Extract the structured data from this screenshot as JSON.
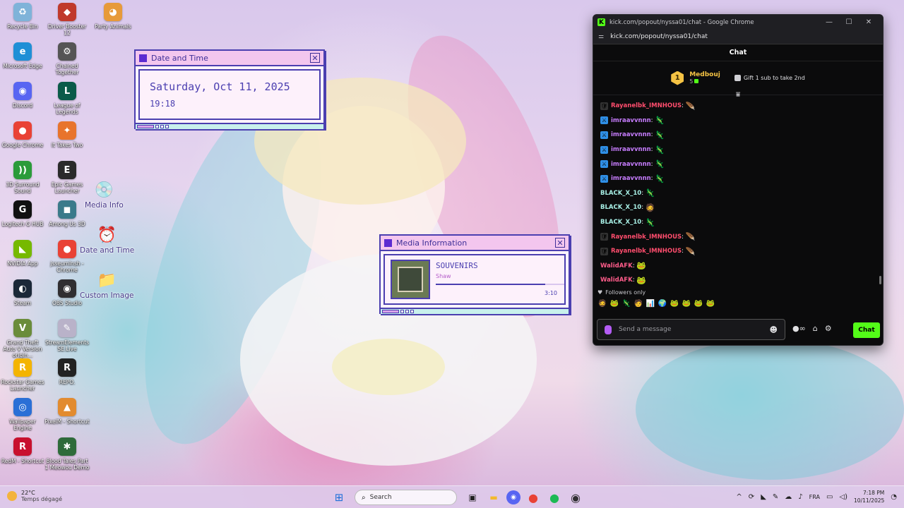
{
  "desktop": {
    "icons_col1": [
      {
        "label": "Recycle Bin",
        "glyph": "♻",
        "color": "#7fb3d9"
      },
      {
        "label": "Microsoft Edge",
        "glyph": "e",
        "color": "#1f8fd6"
      },
      {
        "label": "Discord",
        "glyph": "◉",
        "color": "#5865f2"
      },
      {
        "label": "Google Chrome",
        "glyph": "●",
        "color": "#e94235"
      },
      {
        "label": "3D Surround Sound",
        "glyph": "))",
        "color": "#2b9b3a"
      },
      {
        "label": "Logitech G HUB",
        "glyph": "G",
        "color": "#111111"
      },
      {
        "label": "NVIDIA App",
        "glyph": "◣",
        "color": "#76b900"
      },
      {
        "label": "Steam",
        "glyph": "◐",
        "color": "#1b2838"
      },
      {
        "label": "Grand Theft Auto V Version origin...",
        "glyph": "V",
        "color": "#6a8c3a"
      },
      {
        "label": "Rockstar Games Launcher",
        "glyph": "R",
        "color": "#f4b400"
      },
      {
        "label": "Wallpaper Engine",
        "glyph": "◎",
        "color": "#2a6fd6"
      },
      {
        "label": "RedM - Shortcut",
        "glyph": "R",
        "color": "#c8102e"
      }
    ],
    "icons_col2": [
      {
        "label": "Driver Booster 12",
        "glyph": "◆",
        "color": "#c0392b"
      },
      {
        "label": "Chained Together",
        "glyph": "⚙",
        "color": "#555555"
      },
      {
        "label": "League of Legends",
        "glyph": "L",
        "color": "#0a5b49"
      },
      {
        "label": "It Takes Two",
        "glyph": "✦",
        "color": "#e8742c"
      },
      {
        "label": "Epic Games Launcher",
        "glyph": "E",
        "color": "#2a2a2a"
      },
      {
        "label": "Among Us 3D",
        "glyph": "◼",
        "color": "#3a7a8a"
      },
      {
        "label": "jsseumlnsh - Chrome",
        "glyph": "●",
        "color": "#e94235"
      },
      {
        "label": "OBS Studio",
        "glyph": "◉",
        "color": "#302e31"
      },
      {
        "label": "StreamElements SE.Live",
        "glyph": "✎",
        "color": "#b9b2c9"
      },
      {
        "label": "REPO.",
        "glyph": "R",
        "color": "#222222"
      },
      {
        "label": "PixelM - Shortcut",
        "glyph": "▲",
        "color": "#e28b2f"
      },
      {
        "label": "Blood Tales Part 1 Meowou Demo",
        "glyph": "✱",
        "color": "#2e6b3a"
      }
    ],
    "icon_col3": {
      "label": "Party Animals",
      "glyph": "◕",
      "color": "#e79a3a"
    },
    "widget_shortcuts": [
      {
        "label": "Media Info",
        "glyph": "💿"
      },
      {
        "label": "Date and Time",
        "glyph": "⏰"
      },
      {
        "label": "Custom Image",
        "glyph": "📁"
      }
    ]
  },
  "date_widget": {
    "title": "Date and Time",
    "date": "Saturday, Oct 11, 2025",
    "time": "19:18"
  },
  "media_widget": {
    "title": "Media Information",
    "track": "SOUVENIRS",
    "artist": "Shaw",
    "duration": "3:10",
    "progress": 0.85
  },
  "browser": {
    "window_title": "kick.com/popout/nyssa01/chat - Google Chrome",
    "url": "kick.com/popout/nyssa01/chat",
    "chat_header": "Chat",
    "leader": {
      "rank": "1",
      "name": "Medbouj",
      "count": "5",
      "gift_text": "Gift 1 sub to take 2nd"
    },
    "messages": [
      {
        "user": "Rayanelbk_IMNHOUS",
        "color": "#ff4d6d",
        "badge": "🛡",
        "badge_bg": "#333",
        "emote": "🪶",
        "emote_bg": ""
      },
      {
        "user": "imraavvnnn",
        "color": "#c77dff",
        "badge": "⚔",
        "badge_bg": "#2f8fe6",
        "emote": "🦎",
        "emote_bg": ""
      },
      {
        "user": "imraavvnnn",
        "color": "#c77dff",
        "badge": "⚔",
        "badge_bg": "#2f8fe6",
        "emote": "🦎",
        "emote_bg": ""
      },
      {
        "user": "imraavvnnn",
        "color": "#c77dff",
        "badge": "⚔",
        "badge_bg": "#2f8fe6",
        "emote": "🦎",
        "emote_bg": ""
      },
      {
        "user": "imraavvnnn",
        "color": "#c77dff",
        "badge": "⚔",
        "badge_bg": "#2f8fe6",
        "emote": "🦎",
        "emote_bg": ""
      },
      {
        "user": "imraavvnnn",
        "color": "#c77dff",
        "badge": "⚔",
        "badge_bg": "#2f8fe6",
        "emote": "🦎",
        "emote_bg": ""
      },
      {
        "user": "BLACK_X_10",
        "color": "#a8f0e6",
        "badge": "",
        "badge_bg": "",
        "emote": "🦎",
        "emote_bg": ""
      },
      {
        "user": "BLACK_X_10",
        "color": "#a8f0e6",
        "badge": "",
        "badge_bg": "",
        "emote": "🧔",
        "emote_bg": ""
      },
      {
        "user": "BLACK_X_10",
        "color": "#a8f0e6",
        "badge": "",
        "badge_bg": "",
        "emote": "🦎",
        "emote_bg": ""
      },
      {
        "user": "Rayanelbk_IMNHOUS",
        "color": "#ff4d6d",
        "badge": "🛡",
        "badge_bg": "#333",
        "emote": "🪶",
        "emote_bg": ""
      },
      {
        "user": "Rayanelbk_IMNHOUS",
        "color": "#ff4d6d",
        "badge": "🛡",
        "badge_bg": "#333",
        "emote": "🪶",
        "emote_bg": ""
      },
      {
        "user": "WalidAFK",
        "color": "#ff5c8a",
        "badge": "",
        "badge_bg": "",
        "emote": "🐸",
        "emote_bg": ""
      },
      {
        "user": "WalidAFK",
        "color": "#ff5c8a",
        "badge": "",
        "badge_bg": "",
        "emote": "🐸",
        "emote_bg": ""
      }
    ],
    "followers_only": "Followers only",
    "emote_bar": [
      "🧔",
      "🐸",
      "🦎",
      "🧑",
      "📊",
      "🌍",
      "🐸",
      "🐸",
      "🐸",
      "🐸"
    ],
    "input_placeholder": "Send a message",
    "send_label": "Chat"
  },
  "taskbar": {
    "weather_temp": "22°C",
    "weather_desc": "Temps dégagé",
    "search_label": "Search",
    "lang": "FRA",
    "time": "7:18 PM",
    "date": "10/11/2025"
  }
}
